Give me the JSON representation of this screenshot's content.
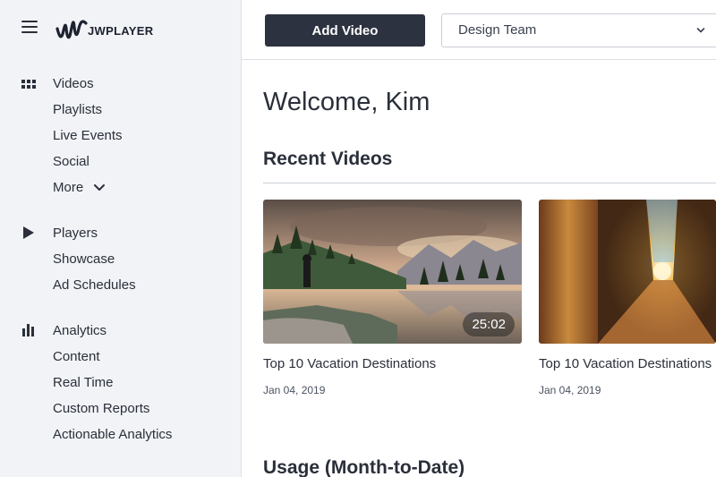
{
  "brand": {
    "logo_text": "JWPLAYER",
    "menu_icon": "hamburger-menu-icon",
    "logo_icon": "jwplayer-logo-icon"
  },
  "sidebar": {
    "groups": [
      {
        "icon": "grid-icon",
        "items": [
          "Videos",
          "Playlists",
          "Live Events",
          "Social"
        ],
        "more_label": "More"
      },
      {
        "icon": "play-icon",
        "items": [
          "Players",
          "Showcase",
          "Ad Schedules"
        ]
      },
      {
        "icon": "bar-chart-icon",
        "items": [
          "Analytics",
          "Content",
          "Real Time",
          "Custom Reports",
          "Actionable Analytics"
        ]
      }
    ]
  },
  "topbar": {
    "add_video_label": "Add Video",
    "team_select_value": "Design Team"
  },
  "main": {
    "welcome": "Welcome, Kim",
    "recent_title": "Recent Videos",
    "usage_title": "Usage (Month-to-Date)",
    "videos": [
      {
        "title": "Top 10 Vacation Destinations",
        "date": "Jan 04, 2019",
        "duration": "25:02"
      },
      {
        "title": "Top 10 Vacation Destinations",
        "date": "Jan 04, 2019",
        "duration": ""
      }
    ]
  },
  "colors": {
    "sidebar_bg": "#f1f3f6",
    "button_bg": "#2d3240",
    "text": "#2a2f3a"
  }
}
